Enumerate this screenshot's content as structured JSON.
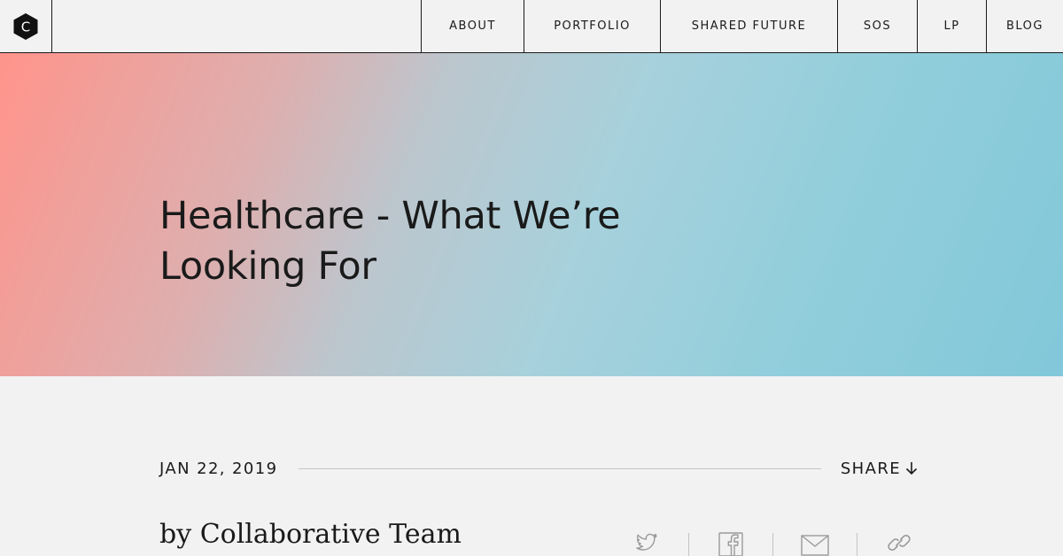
{
  "nav": {
    "logo_letter": "C",
    "logo_icon": "hexagon-c-logo",
    "items": [
      {
        "label": "ABOUT"
      },
      {
        "label": "PORTFOLIO"
      },
      {
        "label": "SHARED FUTURE"
      },
      {
        "label": "SOS"
      },
      {
        "label": "LP"
      },
      {
        "label": "BLOG"
      }
    ]
  },
  "hero": {
    "title": "Healthcare - What We’re Looking For",
    "gradient_colors": [
      "#ff948b",
      "#bcc6cd",
      "#a7d1dc",
      "#82c8da"
    ]
  },
  "post": {
    "date": "JAN 22, 2019",
    "share_label": "SHARE",
    "share_icon": "arrow-down-icon",
    "author": "by Collaborative Team",
    "share_icons": [
      "twitter-icon",
      "facebook-icon",
      "mail-icon",
      "link-icon"
    ]
  },
  "colors": {
    "background": "#f2f2f2",
    "text": "#1a1a1a",
    "rule": "#c4c4c4",
    "icon": "#9a9a9a"
  }
}
